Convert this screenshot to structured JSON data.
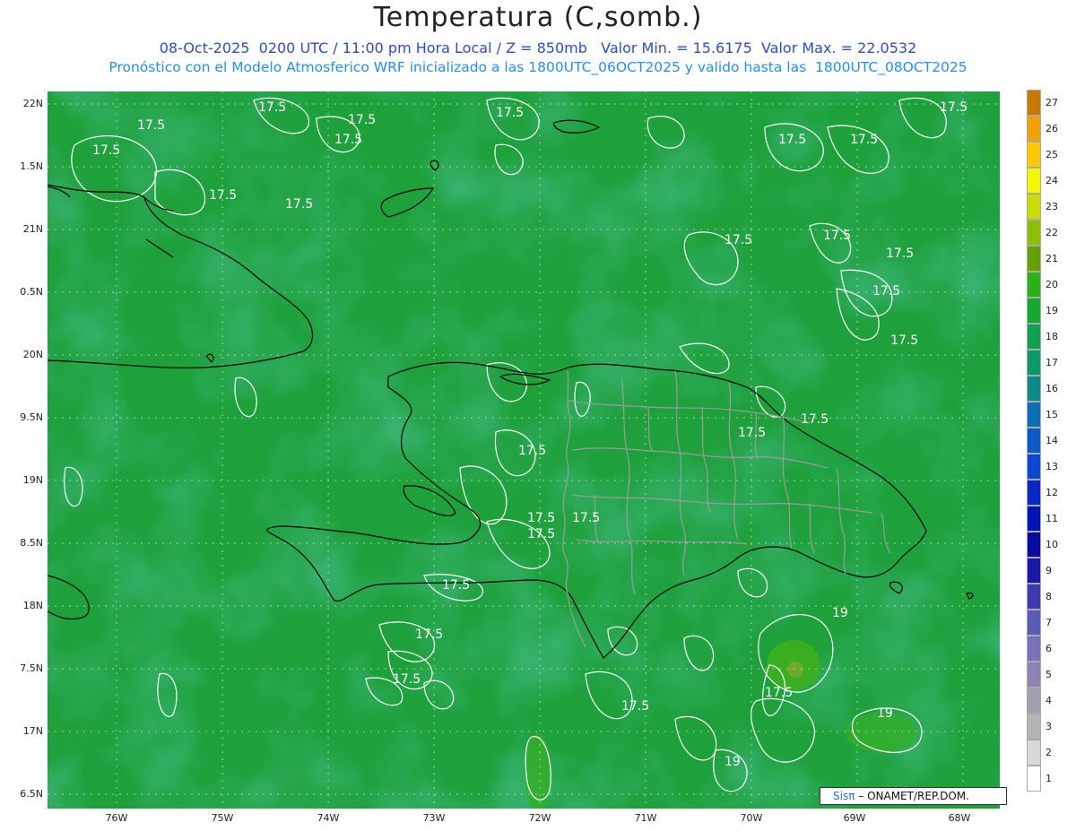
{
  "title": "Temperatura (C,somb.)",
  "subtitle1": "08-Oct-2025  0200 UTC / 11:00 pm Hora Local / Z = 850mb   Valor Min. = 15.6175  Valor Max. = 22.0532",
  "subtitle2": "Pronóstico con el Modelo Atmosferico WRF inicializado a las 1800UTC_06OCT2025 y valido hasta las  1800UTC_08OCT2025",
  "credit": {
    "logo": "Sisπ",
    "text": " – ONAMET/REP.DOM."
  },
  "lat_labels": [
    "22N",
    "1.5N",
    "21N",
    "0.5N",
    "20N",
    "9.5N",
    "19N",
    "8.5N",
    "18N",
    "7.5N",
    "17N",
    "6.5N"
  ],
  "lon_labels": [
    "76W",
    "75W",
    "74W",
    "73W",
    "72W",
    "71W",
    "70W",
    "69W",
    "68W"
  ],
  "colorbar": {
    "levels": [
      "1",
      "2",
      "3",
      "4",
      "5",
      "6",
      "7",
      "8",
      "9",
      "10",
      "11",
      "12",
      "13",
      "14",
      "15",
      "16",
      "17",
      "18",
      "19",
      "20",
      "21",
      "22",
      "23",
      "24",
      "25",
      "26",
      "27"
    ],
    "colors": [
      "#ffffff",
      "#d8d8d8",
      "#b4b4b4",
      "#a0a0ae",
      "#9082b4",
      "#7a72b8",
      "#5a5ab8",
      "#3c3cb0",
      "#1a1aa8",
      "#0a0aa0",
      "#0014b4",
      "#0a28c8",
      "#0c46d2",
      "#0a5ac8",
      "#0a6eb4",
      "#0a8a8a",
      "#0a9a6a",
      "#0fa050",
      "#14aa32",
      "#28b414",
      "#64a000",
      "#8cbe00",
      "#c8dc00",
      "#f5f500",
      "#ffc800",
      "#f0a000",
      "#c87800"
    ]
  },
  "contours": [
    {
      "label": "17.5"
    },
    {
      "label": "17.5"
    },
    {
      "label": "17.5"
    },
    {
      "label": "17.5"
    },
    {
      "label": "17.5"
    },
    {
      "label": "17.5"
    },
    {
      "label": "17.5"
    },
    {
      "label": "17.5"
    },
    {
      "label": "17.5"
    },
    {
      "label": "17.5"
    },
    {
      "label": "17.5"
    },
    {
      "label": "17.5"
    },
    {
      "label": "17.5"
    },
    {
      "label": "17.5"
    },
    {
      "label": "17.5"
    },
    {
      "label": "17.5"
    },
    {
      "label": "17.5"
    },
    {
      "label": "17.5"
    },
    {
      "label": "17.5"
    },
    {
      "label": "17.5"
    },
    {
      "label": "17.5"
    },
    {
      "label": "17.5"
    },
    {
      "label": "17.5"
    },
    {
      "label": "17.5"
    },
    {
      "label": "17.5"
    },
    {
      "label": "17.5"
    },
    {
      "label": "17.5"
    },
    {
      "label": "19"
    },
    {
      "label": "19"
    },
    {
      "label": "19"
    }
  ],
  "colors": {
    "background": "#1e9e3c",
    "coast": "#000000",
    "provinces": "#9a9a9a",
    "contour": "#ffffff",
    "grid": "#b8d8b0"
  }
}
